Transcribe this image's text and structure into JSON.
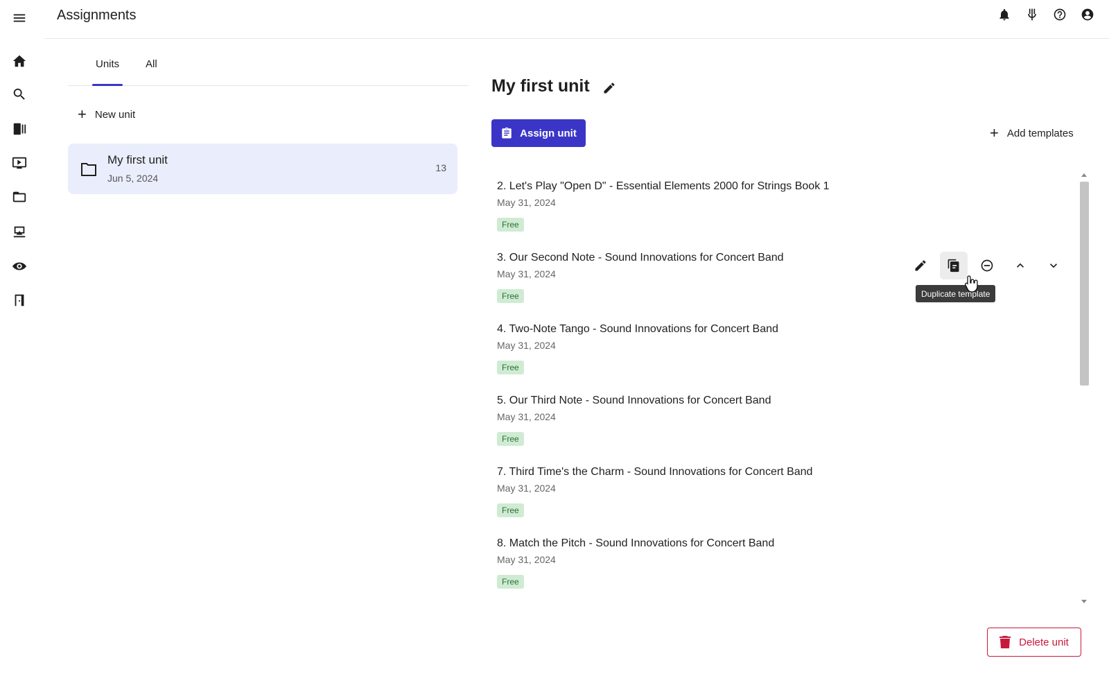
{
  "app": {
    "title": "Assignments"
  },
  "rail": {
    "items": [
      "menu-icon",
      "home-icon",
      "search-icon",
      "library-icon",
      "video-icon",
      "folder-icon",
      "classes-icon",
      "eye-icon",
      "exit-icon"
    ]
  },
  "header": {
    "icons": [
      "bell-icon",
      "tuner-icon",
      "help-icon",
      "account-icon"
    ]
  },
  "left": {
    "tabs": [
      {
        "label": "Units",
        "active": true
      },
      {
        "label": "All",
        "active": false
      }
    ],
    "new_unit_label": "New unit",
    "units": [
      {
        "name": "My first unit",
        "date": "Jun 5, 2024",
        "count": "13"
      }
    ]
  },
  "main": {
    "unit_title": "My first unit",
    "assign_label": "Assign unit",
    "add_templates_label": "Add templates",
    "items": [
      {
        "title": "2. Let's Play \"Open D\" - Essential Elements 2000 for Strings Book 1",
        "date": "May 31, 2024",
        "badge": "Free"
      },
      {
        "title": "3. Our Second Note - Sound Innovations for Concert Band",
        "date": "May 31, 2024",
        "badge": "Free"
      },
      {
        "title": "4. Two-Note Tango - Sound Innovations for Concert Band",
        "date": "May 31, 2024",
        "badge": "Free"
      },
      {
        "title": "5. Our Third Note - Sound Innovations for Concert Band",
        "date": "May 31, 2024",
        "badge": "Free"
      },
      {
        "title": "7. Third Time's the Charm - Sound Innovations for Concert Band",
        "date": "May 31, 2024",
        "badge": "Free"
      },
      {
        "title": "8. Match the Pitch - Sound Innovations for Concert Band",
        "date": "May 31, 2024",
        "badge": "Free"
      }
    ],
    "tooltip": "Duplicate template",
    "delete_label": "Delete unit"
  },
  "colors": {
    "accent": "#3b35c7",
    "danger": "#c8193c",
    "free_badge_bg": "#cfecd3",
    "selected_unit_bg": "#eaedfb"
  }
}
